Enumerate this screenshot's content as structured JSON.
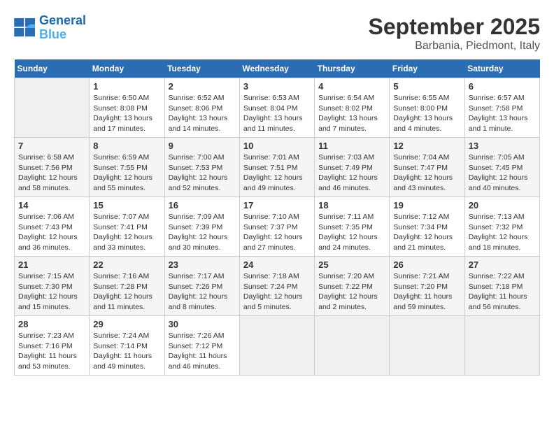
{
  "app": {
    "name_general": "General",
    "name_blue": "Blue"
  },
  "header": {
    "month_year": "September 2025",
    "location": "Barbania, Piedmont, Italy"
  },
  "weekdays": [
    "Sunday",
    "Monday",
    "Tuesday",
    "Wednesday",
    "Thursday",
    "Friday",
    "Saturday"
  ],
  "weeks": [
    [
      {
        "day": "",
        "sunrise": "",
        "sunset": "",
        "daylight": ""
      },
      {
        "day": "1",
        "sunrise": "Sunrise: 6:50 AM",
        "sunset": "Sunset: 8:08 PM",
        "daylight": "Daylight: 13 hours and 17 minutes."
      },
      {
        "day": "2",
        "sunrise": "Sunrise: 6:52 AM",
        "sunset": "Sunset: 8:06 PM",
        "daylight": "Daylight: 13 hours and 14 minutes."
      },
      {
        "day": "3",
        "sunrise": "Sunrise: 6:53 AM",
        "sunset": "Sunset: 8:04 PM",
        "daylight": "Daylight: 13 hours and 11 minutes."
      },
      {
        "day": "4",
        "sunrise": "Sunrise: 6:54 AM",
        "sunset": "Sunset: 8:02 PM",
        "daylight": "Daylight: 13 hours and 7 minutes."
      },
      {
        "day": "5",
        "sunrise": "Sunrise: 6:55 AM",
        "sunset": "Sunset: 8:00 PM",
        "daylight": "Daylight: 13 hours and 4 minutes."
      },
      {
        "day": "6",
        "sunrise": "Sunrise: 6:57 AM",
        "sunset": "Sunset: 7:58 PM",
        "daylight": "Daylight: 13 hours and 1 minute."
      }
    ],
    [
      {
        "day": "7",
        "sunrise": "Sunrise: 6:58 AM",
        "sunset": "Sunset: 7:56 PM",
        "daylight": "Daylight: 12 hours and 58 minutes."
      },
      {
        "day": "8",
        "sunrise": "Sunrise: 6:59 AM",
        "sunset": "Sunset: 7:55 PM",
        "daylight": "Daylight: 12 hours and 55 minutes."
      },
      {
        "day": "9",
        "sunrise": "Sunrise: 7:00 AM",
        "sunset": "Sunset: 7:53 PM",
        "daylight": "Daylight: 12 hours and 52 minutes."
      },
      {
        "day": "10",
        "sunrise": "Sunrise: 7:01 AM",
        "sunset": "Sunset: 7:51 PM",
        "daylight": "Daylight: 12 hours and 49 minutes."
      },
      {
        "day": "11",
        "sunrise": "Sunrise: 7:03 AM",
        "sunset": "Sunset: 7:49 PM",
        "daylight": "Daylight: 12 hours and 46 minutes."
      },
      {
        "day": "12",
        "sunrise": "Sunrise: 7:04 AM",
        "sunset": "Sunset: 7:47 PM",
        "daylight": "Daylight: 12 hours and 43 minutes."
      },
      {
        "day": "13",
        "sunrise": "Sunrise: 7:05 AM",
        "sunset": "Sunset: 7:45 PM",
        "daylight": "Daylight: 12 hours and 40 minutes."
      }
    ],
    [
      {
        "day": "14",
        "sunrise": "Sunrise: 7:06 AM",
        "sunset": "Sunset: 7:43 PM",
        "daylight": "Daylight: 12 hours and 36 minutes."
      },
      {
        "day": "15",
        "sunrise": "Sunrise: 7:07 AM",
        "sunset": "Sunset: 7:41 PM",
        "daylight": "Daylight: 12 hours and 33 minutes."
      },
      {
        "day": "16",
        "sunrise": "Sunrise: 7:09 AM",
        "sunset": "Sunset: 7:39 PM",
        "daylight": "Daylight: 12 hours and 30 minutes."
      },
      {
        "day": "17",
        "sunrise": "Sunrise: 7:10 AM",
        "sunset": "Sunset: 7:37 PM",
        "daylight": "Daylight: 12 hours and 27 minutes."
      },
      {
        "day": "18",
        "sunrise": "Sunrise: 7:11 AM",
        "sunset": "Sunset: 7:35 PM",
        "daylight": "Daylight: 12 hours and 24 minutes."
      },
      {
        "day": "19",
        "sunrise": "Sunrise: 7:12 AM",
        "sunset": "Sunset: 7:34 PM",
        "daylight": "Daylight: 12 hours and 21 minutes."
      },
      {
        "day": "20",
        "sunrise": "Sunrise: 7:13 AM",
        "sunset": "Sunset: 7:32 PM",
        "daylight": "Daylight: 12 hours and 18 minutes."
      }
    ],
    [
      {
        "day": "21",
        "sunrise": "Sunrise: 7:15 AM",
        "sunset": "Sunset: 7:30 PM",
        "daylight": "Daylight: 12 hours and 15 minutes."
      },
      {
        "day": "22",
        "sunrise": "Sunrise: 7:16 AM",
        "sunset": "Sunset: 7:28 PM",
        "daylight": "Daylight: 12 hours and 11 minutes."
      },
      {
        "day": "23",
        "sunrise": "Sunrise: 7:17 AM",
        "sunset": "Sunset: 7:26 PM",
        "daylight": "Daylight: 12 hours and 8 minutes."
      },
      {
        "day": "24",
        "sunrise": "Sunrise: 7:18 AM",
        "sunset": "Sunset: 7:24 PM",
        "daylight": "Daylight: 12 hours and 5 minutes."
      },
      {
        "day": "25",
        "sunrise": "Sunrise: 7:20 AM",
        "sunset": "Sunset: 7:22 PM",
        "daylight": "Daylight: 12 hours and 2 minutes."
      },
      {
        "day": "26",
        "sunrise": "Sunrise: 7:21 AM",
        "sunset": "Sunset: 7:20 PM",
        "daylight": "Daylight: 11 hours and 59 minutes."
      },
      {
        "day": "27",
        "sunrise": "Sunrise: 7:22 AM",
        "sunset": "Sunset: 7:18 PM",
        "daylight": "Daylight: 11 hours and 56 minutes."
      }
    ],
    [
      {
        "day": "28",
        "sunrise": "Sunrise: 7:23 AM",
        "sunset": "Sunset: 7:16 PM",
        "daylight": "Daylight: 11 hours and 53 minutes."
      },
      {
        "day": "29",
        "sunrise": "Sunrise: 7:24 AM",
        "sunset": "Sunset: 7:14 PM",
        "daylight": "Daylight: 11 hours and 49 minutes."
      },
      {
        "day": "30",
        "sunrise": "Sunrise: 7:26 AM",
        "sunset": "Sunset: 7:12 PM",
        "daylight": "Daylight: 11 hours and 46 minutes."
      },
      {
        "day": "",
        "sunrise": "",
        "sunset": "",
        "daylight": ""
      },
      {
        "day": "",
        "sunrise": "",
        "sunset": "",
        "daylight": ""
      },
      {
        "day": "",
        "sunrise": "",
        "sunset": "",
        "daylight": ""
      },
      {
        "day": "",
        "sunrise": "",
        "sunset": "",
        "daylight": ""
      }
    ]
  ]
}
